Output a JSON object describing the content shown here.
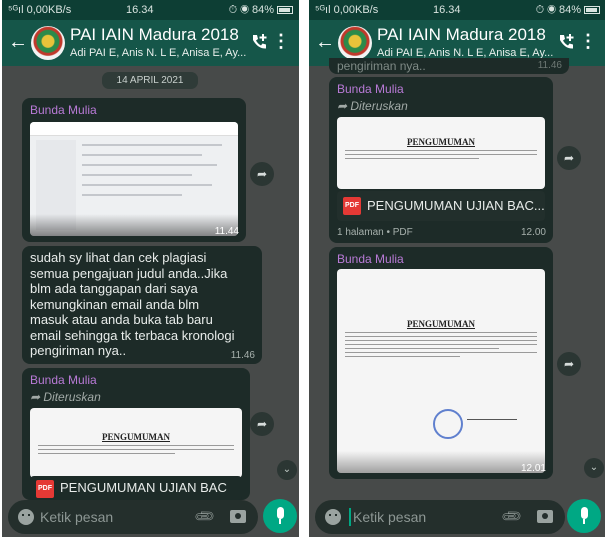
{
  "status": {
    "signal": "⁵ᴳıl 0,00KB/s",
    "time": "16.34",
    "icons": "⏱ ◉ 84%"
  },
  "chat": {
    "title": "PAI IAIN Madura 2018",
    "subtitle": "Adi PAI E, Anis N. L E, Anisa E, Ay..."
  },
  "left": {
    "date": "14 APRIL 2021",
    "msg1": {
      "sender": "Bunda Mulia",
      "time": "11.44"
    },
    "msg2": {
      "lines": [
        "sudah sy lihat dan cek plagiasi",
        "semua pengajuan judul anda..Jika",
        "blm ada tanggapan dari saya",
        "kemungkinan email anda blm",
        "masuk atau anda buka tab baru",
        "email sehingga tk terbaca kronologi",
        "pengiriman nya.."
      ],
      "time": "11.46"
    },
    "msg3": {
      "sender": "Bunda Mulia",
      "forwarded": "Diteruskan",
      "doc_title": "PENGUMUMAN",
      "file": "PENGUMUMAN UJIAN BAC"
    }
  },
  "right": {
    "top_partial": "pengiriman nya..",
    "top_partial_time": "11.46",
    "msg1": {
      "sender": "Bunda Mulia",
      "forwarded": "Diteruskan",
      "doc_title": "PENGUMUMAN",
      "file": "PENGUMUMAN UJIAN BAC...",
      "meta": "1 halaman • PDF",
      "time": "12.00"
    },
    "msg2": {
      "sender": "Bunda Mulia",
      "doc_title": "PENGUMUMAN",
      "time": "12.01"
    }
  },
  "input": {
    "placeholder": "Ketik pesan"
  },
  "icons": {
    "back": "arrow-back-icon",
    "call": "add-call-icon",
    "menu": "more-vert-icon",
    "share": "forward-icon",
    "scroll": "chevron-double-down-icon",
    "emoji": "emoji-icon",
    "attach": "paperclip-icon",
    "camera": "camera-icon",
    "mic": "mic-icon"
  },
  "colors": {
    "header": "#155649",
    "accent": "#00a884",
    "sender": "#b87ad6",
    "bubble": "#1d2b28"
  }
}
